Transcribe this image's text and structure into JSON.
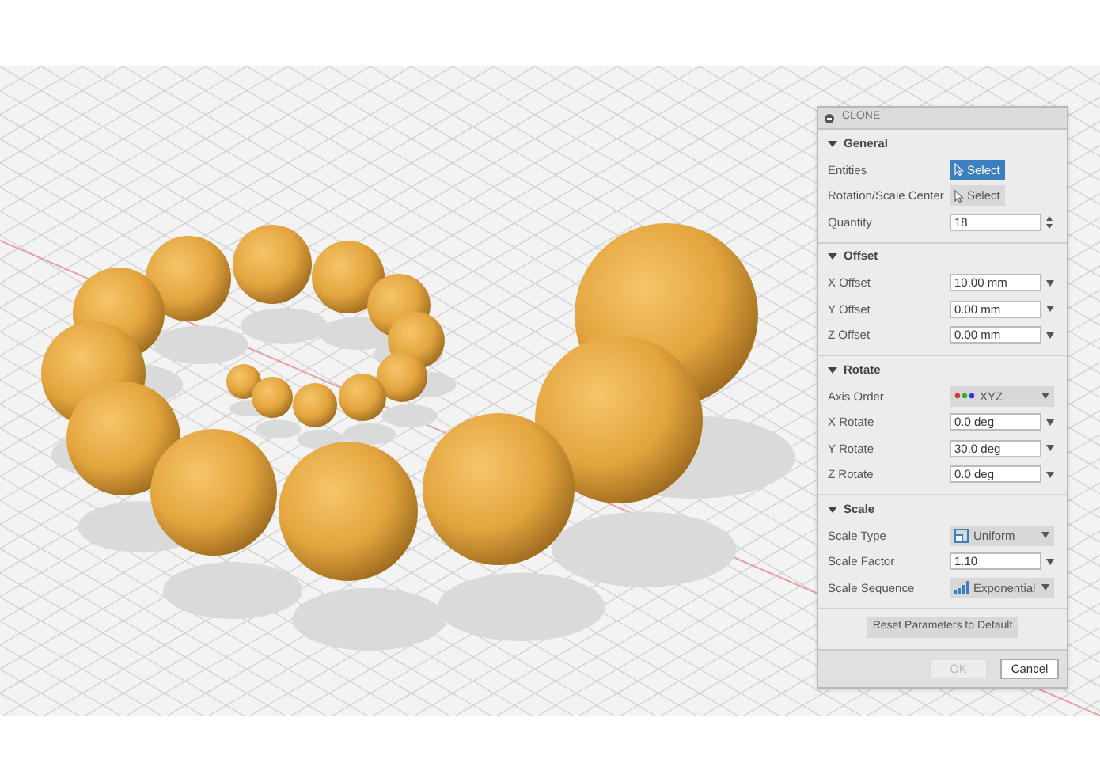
{
  "dialog": {
    "title": "CLONE",
    "sections": [
      {
        "title": "General",
        "expanded": true,
        "rows": [
          {
            "label": "Entities",
            "kind": "select",
            "value": "Select",
            "selected": true
          },
          {
            "label": "Rotation/Scale Center",
            "kind": "select",
            "value": "Select",
            "selected": false
          },
          {
            "label": "Quantity",
            "kind": "spinner",
            "value": "18"
          }
        ]
      },
      {
        "title": "Offset",
        "expanded": true,
        "rows": [
          {
            "label": "X Offset",
            "kind": "input",
            "value": "10.00 mm"
          },
          {
            "label": "Y Offset",
            "kind": "input",
            "value": "0.00 mm"
          },
          {
            "label": "Z Offset",
            "kind": "input",
            "value": "0.00 mm"
          }
        ]
      },
      {
        "title": "Rotate",
        "expanded": true,
        "rows": [
          {
            "label": "Axis Order",
            "kind": "axes",
            "value": "XYZ"
          },
          {
            "label": "X Rotate",
            "kind": "input",
            "value": "0.0 deg"
          },
          {
            "label": "Y Rotate",
            "kind": "input",
            "value": "30.0 deg"
          },
          {
            "label": "Z Rotate",
            "kind": "input",
            "value": "0.0 deg"
          }
        ]
      },
      {
        "title": "Scale",
        "expanded": true,
        "rows": [
          {
            "label": "Scale Type",
            "kind": "shape",
            "value": "Uniform"
          },
          {
            "label": "Scale Factor",
            "kind": "input",
            "value": "1.10"
          },
          {
            "label": "Scale Sequence",
            "kind": "sequence",
            "value": "Exponential"
          }
        ]
      }
    ],
    "reset_button": "Reset Parameters to Default",
    "ok_button": {
      "label": "OK",
      "disabled": true
    },
    "cancel_button": "Cancel"
  }
}
